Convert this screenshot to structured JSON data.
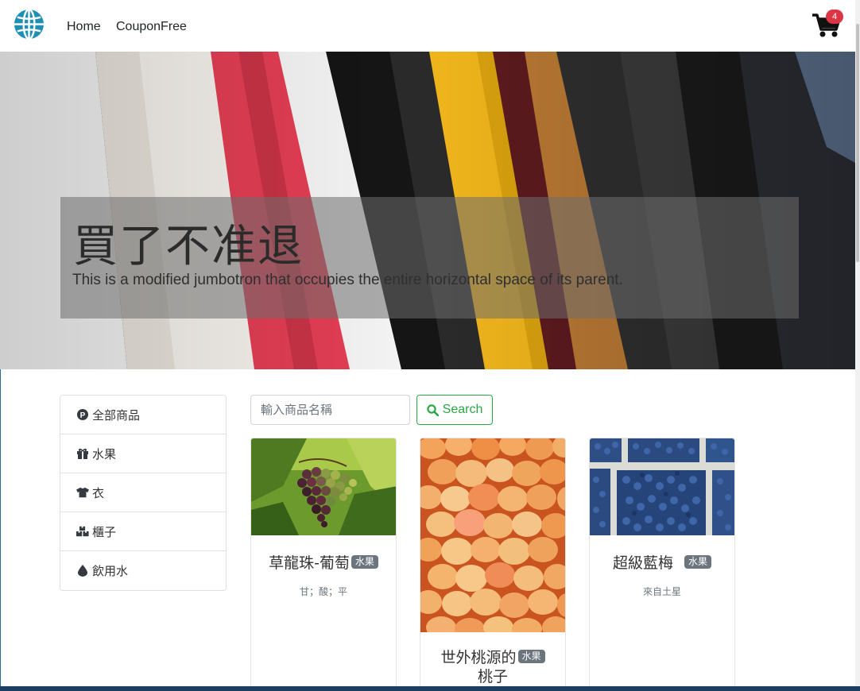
{
  "navbar": {
    "links": [
      "Home",
      "CouponFree"
    ],
    "cart_count": "4"
  },
  "hero": {
    "title": "買了不准退",
    "subtitle": "This is a modified jumbotron that occupies the entire horizontal space of its parent."
  },
  "sidebar": {
    "items": [
      {
        "label": "全部商品",
        "icon": "parking-circle-icon"
      },
      {
        "label": "水果",
        "icon": "gift-icon"
      },
      {
        "label": "衣",
        "icon": "tshirt-icon"
      },
      {
        "label": "櫃子",
        "icon": "boxes-icon"
      },
      {
        "label": "飲用水",
        "icon": "water-drop-icon"
      }
    ]
  },
  "search": {
    "placeholder": "輸入商品名稱",
    "button_label": "Search"
  },
  "products": [
    {
      "name": "草龍珠-葡萄",
      "badge": "水果",
      "desc": "甘；酸；平"
    },
    {
      "name": "世外桃源的桃子",
      "name_line1": "世外桃源的",
      "name_line2": "桃子",
      "badge": "水果",
      "desc": ""
    },
    {
      "name": "超級藍梅",
      "badge": "水果",
      "desc": "來自土星"
    }
  ],
  "colors": {
    "accent_green": "#28a745",
    "badge_red": "#dc3545",
    "badge_gray": "#6c757d",
    "logo_blue": "#1f8fb5"
  }
}
